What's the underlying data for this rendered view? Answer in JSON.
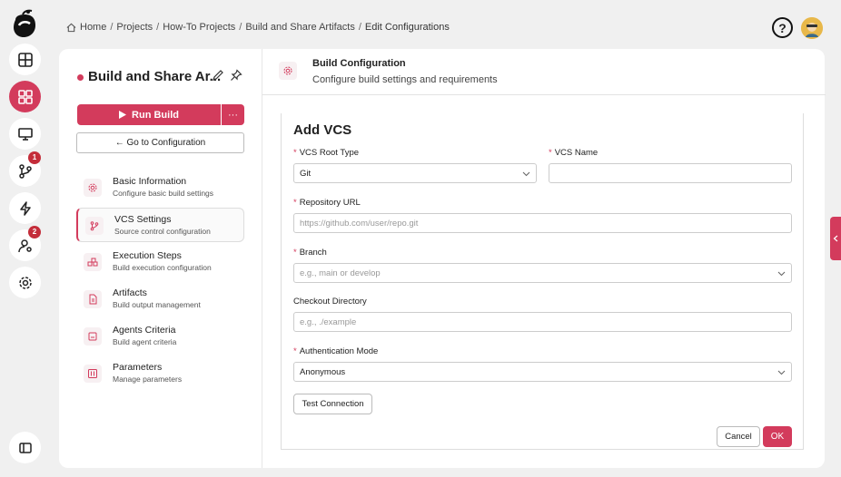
{
  "breadcrumb": {
    "items": [
      "Home",
      "Projects",
      "How-To Projects",
      "Build and Share Artifacts"
    ],
    "current": "Edit Configurations",
    "separator": "/"
  },
  "header": {
    "help_label": "?"
  },
  "rail": {
    "badges": {
      "git": "1",
      "agents": "2"
    }
  },
  "project": {
    "title": "Build and Share Ar...",
    "run_label": "Run Build",
    "more_label": "···",
    "goto_label": "← Go to Configuration"
  },
  "nav": {
    "items": [
      {
        "title": "Basic Information",
        "subtitle": "Configure basic build settings"
      },
      {
        "title": "VCS Settings",
        "subtitle": "Source control configuration"
      },
      {
        "title": "Execution Steps",
        "subtitle": "Build execution configuration"
      },
      {
        "title": "Artifacts",
        "subtitle": "Build output management"
      },
      {
        "title": "Agents Criteria",
        "subtitle": "Build agent criteria"
      },
      {
        "title": "Parameters",
        "subtitle": "Manage parameters"
      }
    ]
  },
  "main": {
    "title": "Build Configuration",
    "subtitle": "Configure build settings and requirements"
  },
  "form": {
    "title": "Add VCS",
    "vcs_root_type": {
      "label": "VCS Root Type",
      "value": "Git"
    },
    "vcs_name": {
      "label": "VCS Name",
      "value": ""
    },
    "repo_url": {
      "label": "Repository URL",
      "placeholder": "https://github.com/user/repo.git"
    },
    "branch": {
      "label": "Branch",
      "placeholder": "e.g., main or develop"
    },
    "checkout_dir": {
      "label": "Checkout Directory",
      "placeholder": "e.g., ./example"
    },
    "auth_mode": {
      "label": "Authentication Mode",
      "value": "Anonymous"
    },
    "test_label": "Test Connection",
    "cancel_label": "Cancel",
    "ok_label": "OK",
    "required_mark": "*"
  },
  "colors": {
    "accent": "#d33b5c",
    "badge": "#c42d3a"
  }
}
